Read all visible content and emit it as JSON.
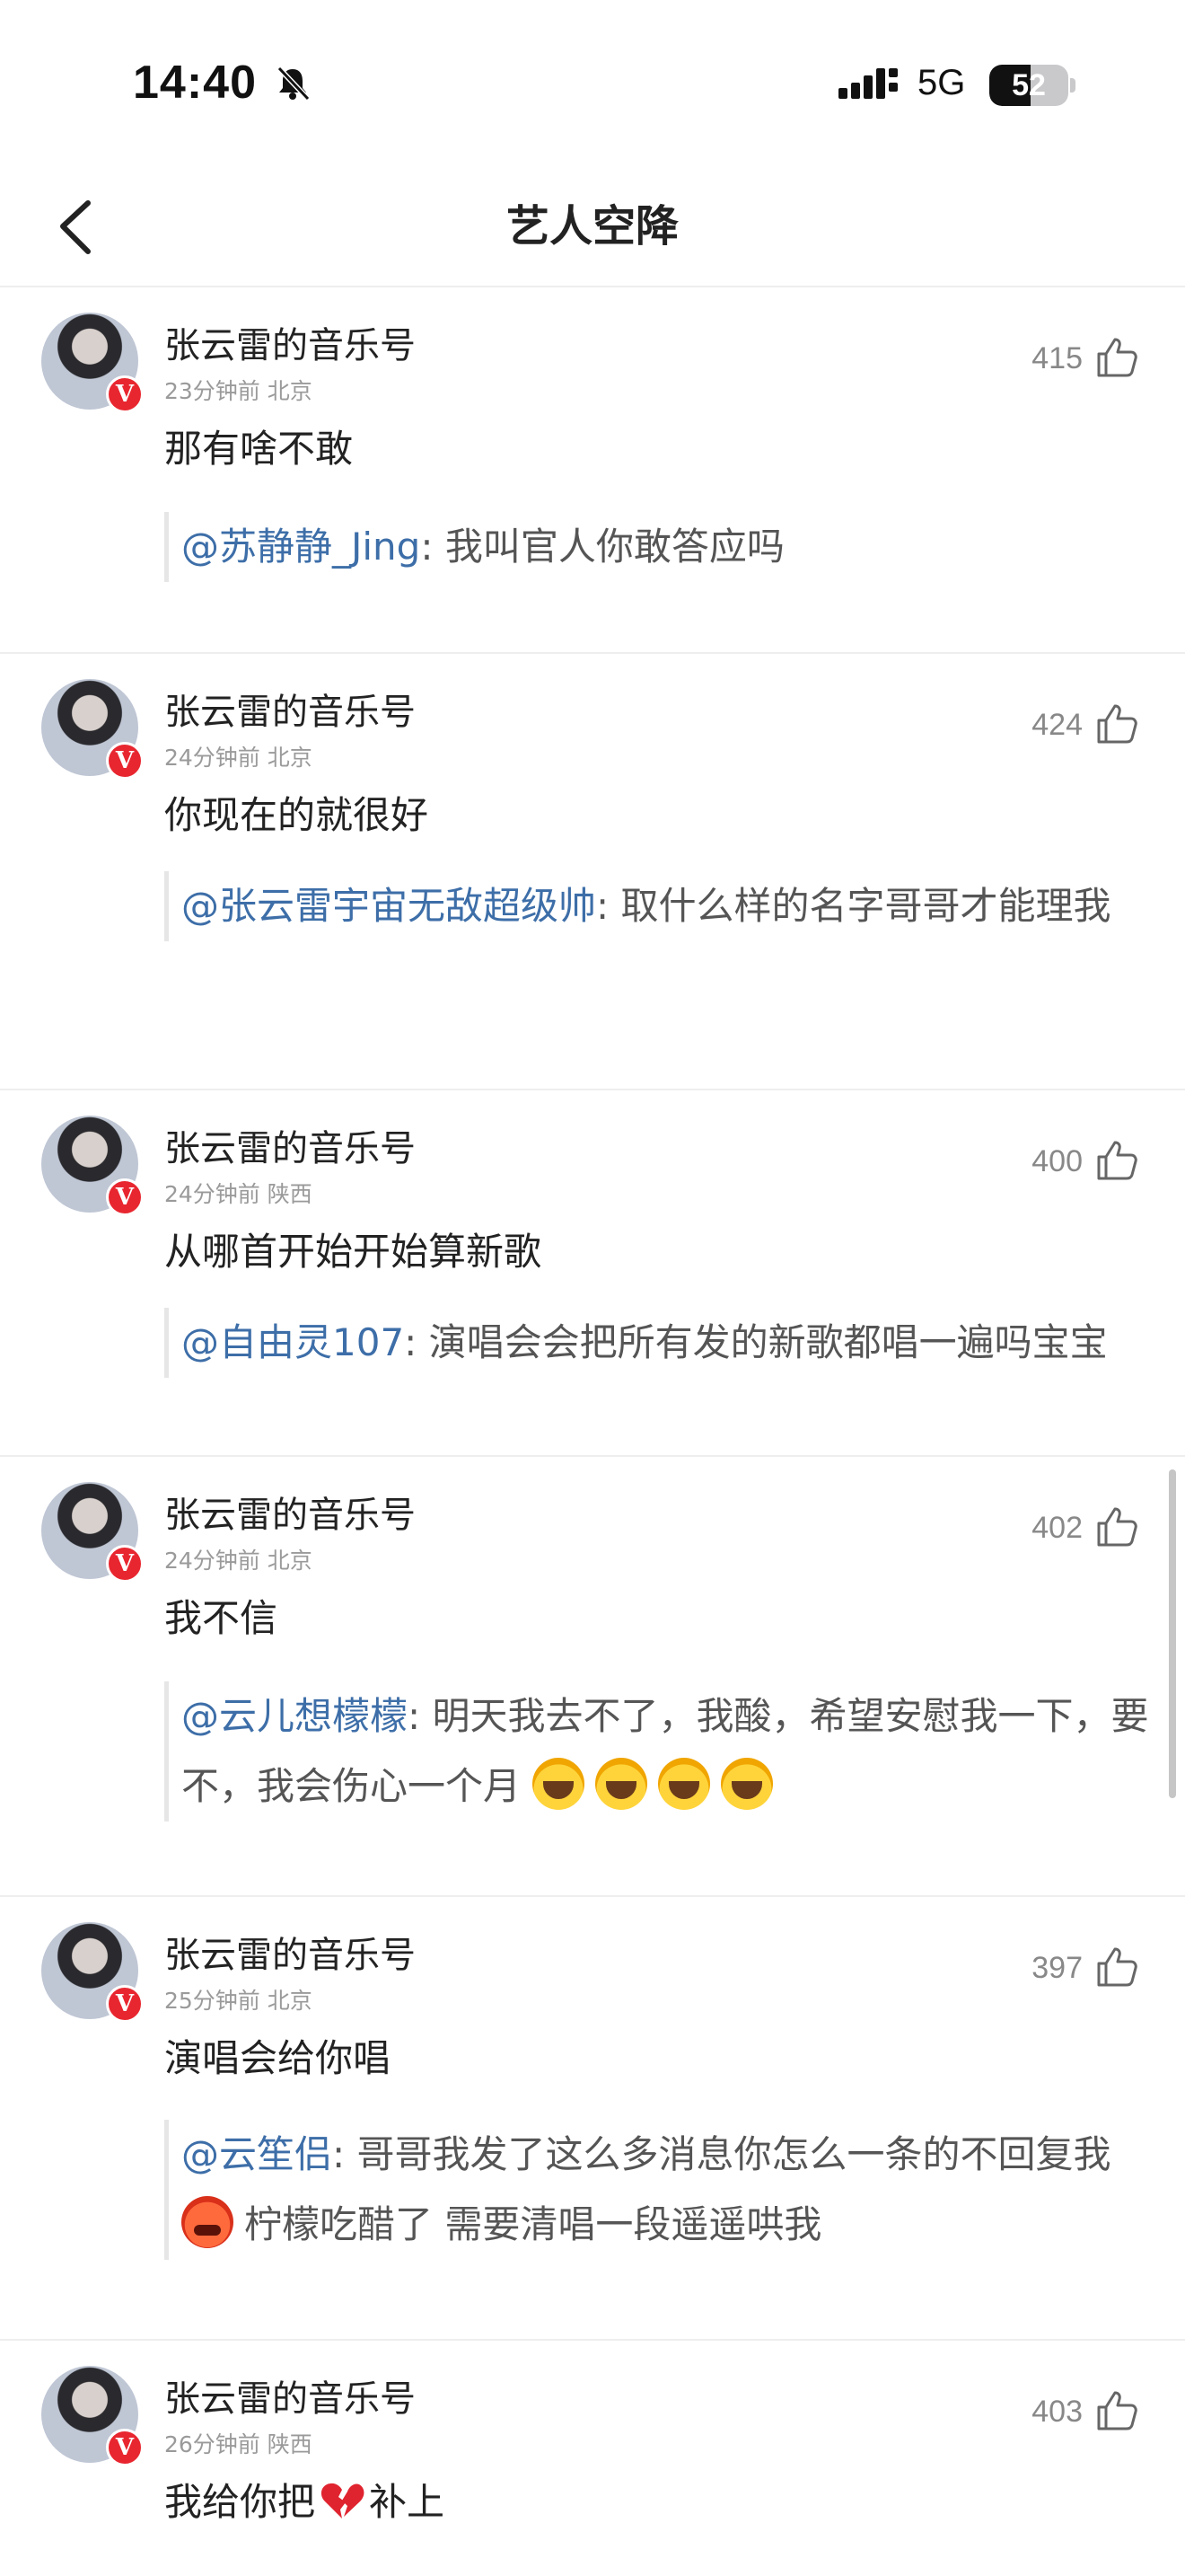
{
  "status_bar": {
    "time": "14:40",
    "network": "5G",
    "battery": "52",
    "battery_level": 0.52
  },
  "nav": {
    "title": "艺人空降"
  },
  "comments": [
    {
      "author": "张云雷的音乐号",
      "time_location": "23分钟前 北京",
      "likes": "415",
      "text": "那有啥不敢",
      "quote_user": "@苏静静_Jing",
      "quote_text": ": 我叫官人你敢答应吗"
    },
    {
      "author": "张云雷的音乐号",
      "time_location": "24分钟前 北京",
      "likes": "424",
      "text": "你现在的就很好",
      "quote_user": "@张云雷宇宙无敌超级帅",
      "quote_text": ": 取什么样的名字哥哥才能理我"
    },
    {
      "author": "张云雷的音乐号",
      "time_location": "24分钟前 陕西",
      "likes": "400",
      "text": "从哪首开始开始算新歌",
      "quote_user": "@自由灵107",
      "quote_text": ": 演唱会会把所有发的新歌都唱一遍吗宝宝"
    },
    {
      "author": "张云雷的音乐号",
      "time_location": "24分钟前 北京",
      "likes": "402",
      "text": "我不信",
      "quote_user": "@云儿想檬檬",
      "quote_text": ": 明天我去不了，我酸，希望安慰我一下，要不，我会伤心一个月"
    },
    {
      "author": "张云雷的音乐号",
      "time_location": "25分钟前 北京",
      "likes": "397",
      "text": "演唱会给你唱",
      "quote_user": "@云笙侣",
      "quote_text_1": ": 哥哥我发了这么多消息你怎么一条的不回复我",
      "quote_text_2": "柠檬吃醋了  需要清唱一段遥遥哄我"
    },
    {
      "author": "张云雷的音乐号",
      "time_location": "26分钟前 陕西",
      "likes": "403",
      "text_1": "我给你把",
      "text_2": "补上"
    }
  ],
  "icons": {
    "back": "chevron-left-icon",
    "like": "thumbs-up-icon",
    "bell_off": "bell-slash-icon",
    "verified": "verified-v-badge",
    "cry_emoji": "crying-face-emoji",
    "angry_emoji": "angry-face-emoji",
    "broken_heart": "broken-heart-emoji"
  },
  "colors": {
    "mention": "#3d6ea8",
    "badge": "#e8262f",
    "divider": "#eeeeee"
  }
}
